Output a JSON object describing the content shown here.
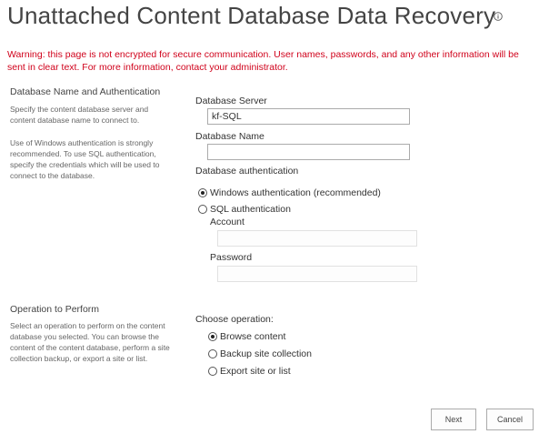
{
  "page": {
    "title": "Unattached Content Database Data Recovery",
    "warning": "Warning: this page is not encrypted for secure communication. User names, passwords, and any other information will be sent in clear text. For more information, contact your administrator."
  },
  "icons": {
    "title_info": "info-icon"
  },
  "colors": {
    "warning_text": "#d0021b",
    "title_text": "#444444"
  },
  "database_section": {
    "title": "Database Name and Authentication",
    "description_1": "Specify the content database server and content database name to connect to.",
    "description_2": "Use of Windows authentication is strongly recommended. To use SQL authentication, specify the credentials which will be used to connect to the database.",
    "server_label": "Database Server",
    "server_value": "kf-SQL",
    "name_label": "Database Name",
    "name_value": "",
    "auth_label": "Database authentication",
    "auth_options": [
      {
        "label": "Windows authentication (recommended)",
        "checked": true
      },
      {
        "label": "SQL authentication",
        "checked": false
      }
    ],
    "account_label": "Account",
    "account_value": "",
    "password_label": "Password",
    "password_value": ""
  },
  "operation_section": {
    "title": "Operation to Perform",
    "description": "Select an operation to perform on the content database you selected. You can browse the content of the content database, perform a site collection backup, or export a site or list.",
    "choose_label": "Choose operation:",
    "options": [
      {
        "label": "Browse content",
        "checked": true
      },
      {
        "label": "Backup site collection",
        "checked": false
      },
      {
        "label": "Export site or list",
        "checked": false
      }
    ]
  },
  "buttons": {
    "next": "Next",
    "cancel": "Cancel"
  }
}
